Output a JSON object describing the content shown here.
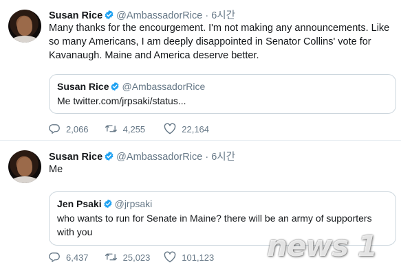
{
  "tweets": [
    {
      "display_name": "Susan Rice",
      "handle": "@AmbassadorRice",
      "dot": "·",
      "time": "6시간",
      "text": "Many thanks for the encourgement. I'm not making any announcements. Like so many Americans, I am deeply disappointed in Senator Collins' vote for Kavanaugh. Maine and America deserve better.",
      "quote": {
        "display_name": "Susan Rice",
        "handle": "@AmbassadorRice",
        "text": "Me twitter.com/jrpsaki/status..."
      },
      "replies": "2,066",
      "retweets": "4,255",
      "likes": "22,164"
    },
    {
      "display_name": "Susan Rice",
      "handle": "@AmbassadorRice",
      "dot": "·",
      "time": "6시간",
      "text": "Me",
      "quote": {
        "display_name": "Jen Psaki",
        "handle": "@jrpsaki",
        "text": "who wants to run for Senate in Maine? there will be an army of supporters with you"
      },
      "replies": "6,437",
      "retweets": "25,023",
      "likes": "101,123"
    }
  ],
  "watermark": "news 1",
  "icons": {
    "verified": "verified-badge-icon",
    "reply": "reply-icon",
    "retweet": "retweet-icon",
    "like": "heart-icon"
  },
  "colors": {
    "verified": "#1da1f2",
    "muted": "#657786",
    "border": "#ccd6dd",
    "text": "#14171a"
  }
}
